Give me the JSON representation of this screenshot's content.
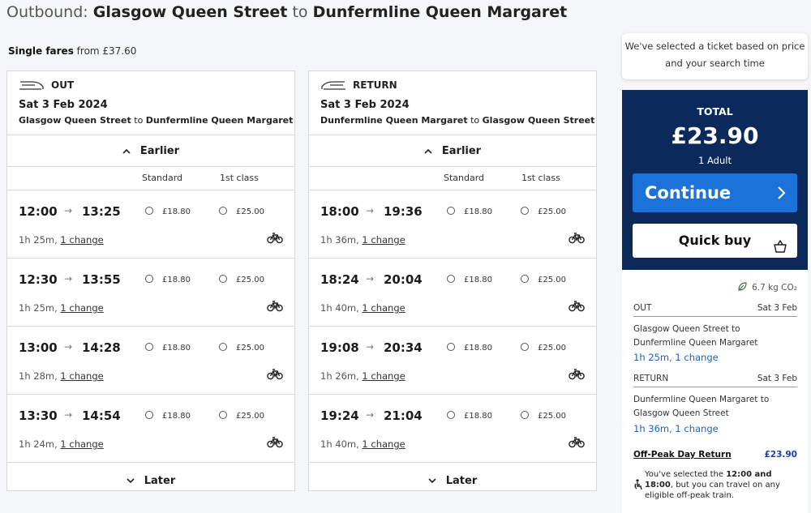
{
  "page": {
    "title_prefix": "Outbound:",
    "origin": "Glasgow Queen Street",
    "to_word": "to",
    "destination": "Dunfermline Queen Margaret",
    "single_label": "Single fares",
    "single_from": "from £37.60"
  },
  "outbound": {
    "label": "OUT",
    "date": "Sat 3 Feb 2024",
    "from": "Glasgow Queen Street",
    "to_word": "to",
    "to": "Dunfermline Queen Margaret",
    "earlier": "Earlier",
    "later": "Later",
    "col_standard": "Standard",
    "col_first": "1st class",
    "rows": [
      {
        "dep": "12:00",
        "arr": "13:25",
        "std": "£18.80",
        "first": "£25.00",
        "dur": "1h 25m,",
        "changes": "1 change"
      },
      {
        "dep": "12:30",
        "arr": "13:55",
        "std": "£18.80",
        "first": "£25.00",
        "dur": "1h 25m,",
        "changes": "1 change"
      },
      {
        "dep": "13:00",
        "arr": "14:28",
        "std": "£18.80",
        "first": "£25.00",
        "dur": "1h 28m,",
        "changes": "1 change"
      },
      {
        "dep": "13:30",
        "arr": "14:54",
        "std": "£18.80",
        "first": "£25.00",
        "dur": "1h 24m,",
        "changes": "1 change"
      }
    ]
  },
  "return": {
    "label": "RETURN",
    "date": "Sat 3 Feb 2024",
    "from": "Dunfermline Queen Margaret",
    "to_word": "to",
    "to": "Glasgow Queen Street",
    "earlier": "Earlier",
    "later": "Later",
    "col_standard": "Standard",
    "col_first": "1st class",
    "rows": [
      {
        "dep": "18:00",
        "arr": "19:36",
        "std": "£18.80",
        "first": "£25.00",
        "dur": "1h 36m,",
        "changes": "1 change"
      },
      {
        "dep": "18:24",
        "arr": "20:04",
        "std": "£18.80",
        "first": "£25.00",
        "dur": "1h 40m,",
        "changes": "1 change"
      },
      {
        "dep": "19:08",
        "arr": "20:34",
        "std": "£18.80",
        "first": "£25.00",
        "dur": "1h 26m,",
        "changes": "1 change"
      },
      {
        "dep": "19:24",
        "arr": "21:04",
        "std": "£18.80",
        "first": "£25.00",
        "dur": "1h 40m,",
        "changes": "1 change"
      }
    ]
  },
  "sidebar": {
    "tip": "We've selected a ticket based on price and your search time",
    "total_label": "TOTAL",
    "total": "£23.90",
    "passengers": "1 Adult",
    "continue": "Continue",
    "quick_buy": "Quick buy",
    "co2": "6.7 kg CO₂",
    "out_label": "OUT",
    "out_date": "Sat 3 Feb",
    "out_route": "Glasgow Queen Street to Dunfermline Queen Margaret",
    "out_dur": "1h 25m, 1 change",
    "ret_label": "RETURN",
    "ret_date": "Sat 3 Feb",
    "ret_route": "Dunfermline Queen Margaret to Glasgow Queen Street",
    "ret_dur": "1h 36m, 1 change",
    "ticket_name": "Off-Peak Day Return",
    "ticket_price": "£23.90",
    "note_pre": "You've selected the ",
    "note_times": "12:00 and 18:00",
    "note_post": ", but you can travel on any eligible off-peak train."
  },
  "colors": {
    "navy": "#0b2a5b",
    "continue_blue": "#1b73d9",
    "link_blue": "#1b62c4",
    "eco_green": "#2e7d32"
  }
}
